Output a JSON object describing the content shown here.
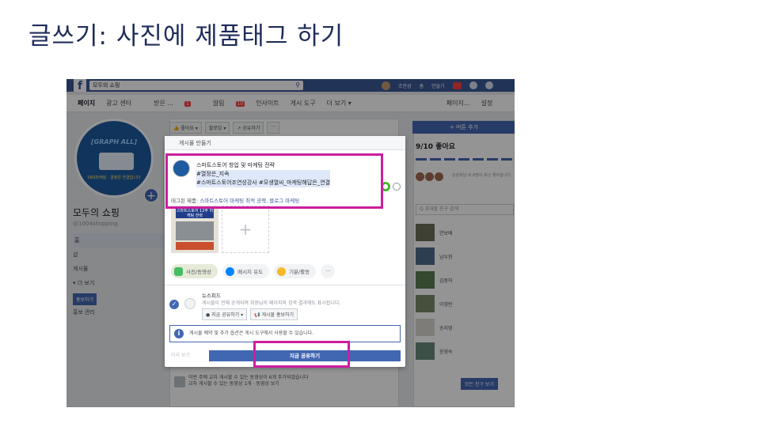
{
  "slide": {
    "title": "글쓰기: 사진에 제품태그 하기"
  },
  "fb_header": {
    "logo": "f",
    "search_value": "모두의 쇼핑",
    "search_icon": "search-icon",
    "user_name": "조만성",
    "home_label": "홈",
    "create_label": "만들기"
  },
  "page_nav": {
    "items": [
      {
        "label": "페이지"
      },
      {
        "label": "광고 센터"
      },
      {
        "label": "받은 ..."
      },
      {
        "label": "알림",
        "badge": "10"
      },
      {
        "label": "인사이트"
      },
      {
        "label": "게시 도구"
      },
      {
        "label": "더 보기 ▾"
      }
    ],
    "right": [
      {
        "label": "페이지..."
      },
      {
        "label": "설정"
      }
    ],
    "inbox_badge": "1"
  },
  "profile": {
    "pic_title": "[GRAPH ALL]",
    "pic_sub": "SNS마케팅 · 결정은 연결입니다",
    "name": "모두의 쇼핑",
    "handle": "@1004shopping",
    "nav": [
      {
        "label": "홈"
      },
      {
        "label": "샵"
      },
      {
        "label": "게시물"
      },
      {
        "label": "▾ 더 보기"
      }
    ],
    "promote": "홍보하기",
    "manage_promo": "홍보 관리"
  },
  "toolbar": {
    "like": "👍 좋아요 ▾",
    "follow": "팔로잉 ▾",
    "share": "↗ 공유하기",
    "more": "···"
  },
  "right_col": {
    "add_button": "+ 버튼 추가",
    "likes": "9/10 좋아요",
    "friends_note": "손광회님 외 8명이 최근 좋아합니다",
    "invite_placeholder": "Q 초대할 친구 검색",
    "friends": [
      {
        "name": "연보배"
      },
      {
        "name": "남우현"
      },
      {
        "name": "김중하"
      },
      {
        "name": "이영란"
      },
      {
        "name": "송지영"
      },
      {
        "name": "윤영숙"
      }
    ],
    "all_friends": "모든 친구 보기"
  },
  "bottom_note": {
    "line1": "이번 주에 교차 게시할 수 있는 동영상이 6개 추가되었습니다",
    "line2": "교차 게시할 수 있는 동영상 1개 · 동영상 보기"
  },
  "dialog": {
    "header": "게시물 만들기",
    "post_lines": [
      "스마트스토어 창업 및 마케팅 전략",
      "#열정은_지속",
      "#스마트스토어조연성강사 #모생열씨_마케팅해답은_연결"
    ],
    "tag_prefix": "태그된 제품: ",
    "tag_links": "스마트스토어 마케팅 최적 공략, 블로그 마케팅",
    "thumb_caption": "스마트스토어 12주 마케팅 전략",
    "chips": [
      {
        "label": "사진/동영상",
        "icon": "photo-icon",
        "color": "#45bd62"
      },
      {
        "label": "메시지 유도",
        "icon": "messenger-icon",
        "color": "#0084ff"
      },
      {
        "label": "기분/활동",
        "icon": "smile-icon",
        "color": "#f7b928"
      }
    ],
    "more_chip": "···",
    "newsfeed_title": "뉴스피드",
    "newsfeed_desc": "게시물이 전체 공개되며 회원님의 페이지와 검색 결과에도 표시됩니다.",
    "share_now_dropdown": "● 지금 공유하기 ▾",
    "boost_post": "📢 게시물 홍보하기",
    "info_text": "게시물 예약 및 추가 옵션은 게시 도구에서 사용할 수 있습니다.",
    "preview": "미리 보기",
    "share_now": "지금 공유하기"
  },
  "colors": {
    "fb_blue": "#3b5998",
    "button_blue": "#4267b2",
    "highlight_magenta": "#cc1e9f",
    "title_navy": "#1f2d5a"
  }
}
